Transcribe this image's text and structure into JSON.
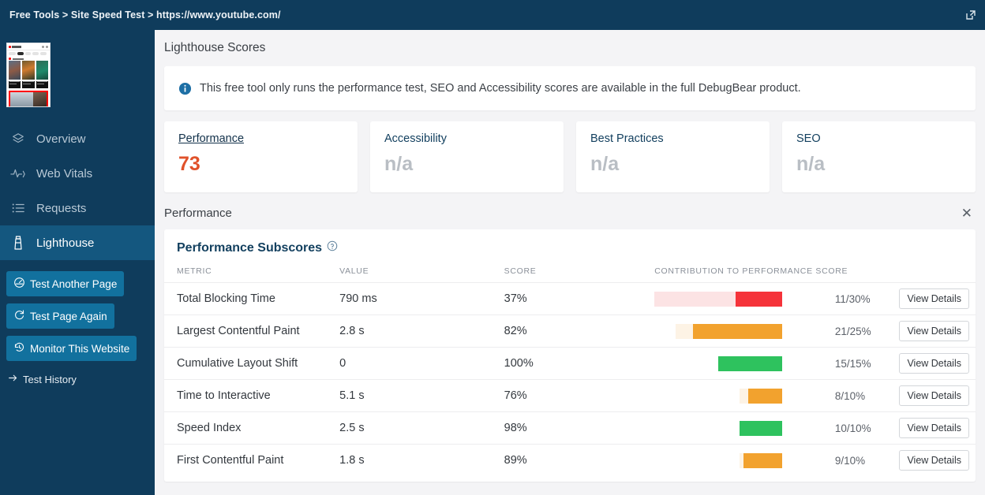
{
  "topbar": {
    "breadcrumb": "Free Tools > Site Speed Test > https://www.youtube.com/",
    "external_link_icon": "external-link-icon"
  },
  "sidebar": {
    "thumbnail_alt": "youtube-page-thumbnail",
    "nav": [
      {
        "label": "Overview",
        "icon": "layers-icon",
        "active": false
      },
      {
        "label": "Web Vitals",
        "icon": "pulse-icon",
        "active": false
      },
      {
        "label": "Requests",
        "icon": "list-icon",
        "active": false
      },
      {
        "label": "Lighthouse",
        "icon": "lighthouse-icon",
        "active": true
      }
    ],
    "buttons": [
      {
        "label": "Test Another Page",
        "icon": "gauge-icon"
      },
      {
        "label": "Test Page Again",
        "icon": "refresh-icon"
      },
      {
        "label": "Monitor This Website",
        "icon": "history-icon"
      }
    ],
    "history_link": {
      "label": "Test History",
      "icon": "arrow-right-icon"
    }
  },
  "main": {
    "section_title": "Lighthouse Scores",
    "notice": {
      "icon": "info-icon",
      "text": "This free tool only runs the performance test, SEO and Accessibility scores are available in the full DebugBear product."
    },
    "score_cards": [
      {
        "title": "Performance",
        "score": "73",
        "has_value": true,
        "underlined": true
      },
      {
        "title": "Accessibility",
        "score": "n/a",
        "has_value": false,
        "underlined": false
      },
      {
        "title": "Best Practices",
        "score": "n/a",
        "has_value": false,
        "underlined": false
      },
      {
        "title": "SEO",
        "score": "n/a",
        "has_value": false,
        "underlined": false
      }
    ],
    "perf_section": {
      "title": "Performance",
      "close_icon": "close-icon",
      "subscores_title": "Performance Subscores",
      "help_icon": "help-circle-icon"
    },
    "view_details_label": "View Details"
  },
  "chart_data": {
    "type": "bar",
    "title": "Performance Subscores",
    "xlabel": "",
    "ylabel": "Contribution to performance score (%)",
    "columns": [
      "METRIC",
      "VALUE",
      "SCORE",
      "CONTRIBUTION TO PERFORMANCE SCORE",
      "",
      ""
    ],
    "axis_max_weight": 30,
    "grid": false,
    "legend": "none",
    "rows": [
      {
        "metric": "Total Blocking Time",
        "value": "790 ms",
        "score": "37%",
        "score_pct": 37,
        "contribution": "11/30%",
        "earned": 11,
        "weight": 30,
        "color": "#f5333a",
        "track": "#fce3e4"
      },
      {
        "metric": "Largest Contentful Paint",
        "value": "2.8 s",
        "score": "82%",
        "score_pct": 82,
        "contribution": "21/25%",
        "earned": 21,
        "weight": 25,
        "color": "#f2a22e",
        "track": "#fdf3e5"
      },
      {
        "metric": "Cumulative Layout Shift",
        "value": "0",
        "score": "100%",
        "score_pct": 100,
        "contribution": "15/15%",
        "earned": 15,
        "weight": 15,
        "color": "#2ec25e",
        "track": "#e6f7ec"
      },
      {
        "metric": "Time to Interactive",
        "value": "5.1 s",
        "score": "76%",
        "score_pct": 76,
        "contribution": "8/10%",
        "earned": 8,
        "weight": 10,
        "color": "#f2a22e",
        "track": "#fdf3e5"
      },
      {
        "metric": "Speed Index",
        "value": "2.5 s",
        "score": "98%",
        "score_pct": 98,
        "contribution": "10/10%",
        "earned": 10,
        "weight": 10,
        "color": "#2ec25e",
        "track": "#e6f7ec"
      },
      {
        "metric": "First Contentful Paint",
        "value": "1.8 s",
        "score": "89%",
        "score_pct": 89,
        "contribution": "9/10%",
        "earned": 9,
        "weight": 10,
        "color": "#f2a22e",
        "track": "#fdf3e5"
      }
    ]
  },
  "colors": {
    "navy": "#0f3c5c",
    "navy_active": "#14577f",
    "button_blue": "#12719e",
    "accent_orange": "#e0512a",
    "page_bg": "#f4f4f6"
  }
}
